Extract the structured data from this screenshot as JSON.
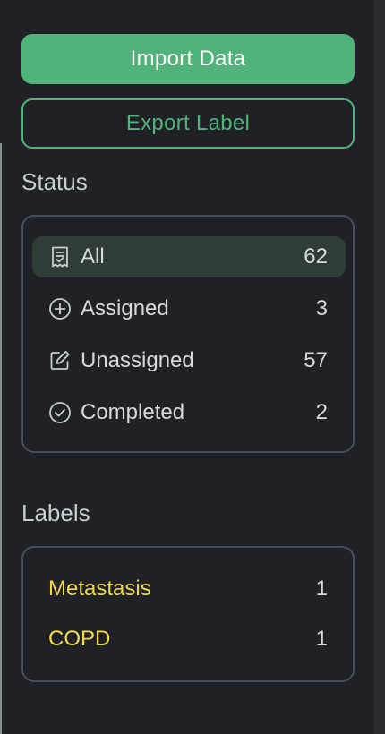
{
  "actions": {
    "import_label": "Import Data",
    "export_label": "Export Label"
  },
  "status": {
    "title": "Status",
    "items": [
      {
        "label": "All",
        "count": "62",
        "icon": "document-list-icon"
      },
      {
        "label": "Assigned",
        "count": "3",
        "icon": "plus-circle-icon"
      },
      {
        "label": "Unassigned",
        "count": "57",
        "icon": "edit-icon"
      },
      {
        "label": "Completed",
        "count": "2",
        "icon": "check-circle-icon"
      }
    ]
  },
  "labels": {
    "title": "Labels",
    "items": [
      {
        "name": "Metastasis",
        "count": "1"
      },
      {
        "name": "COPD",
        "count": "1"
      }
    ]
  },
  "colors": {
    "accent": "#52b37a",
    "label_yellow": "#f0d94a",
    "background": "#1f2126",
    "active_row": "#2f3d36"
  }
}
